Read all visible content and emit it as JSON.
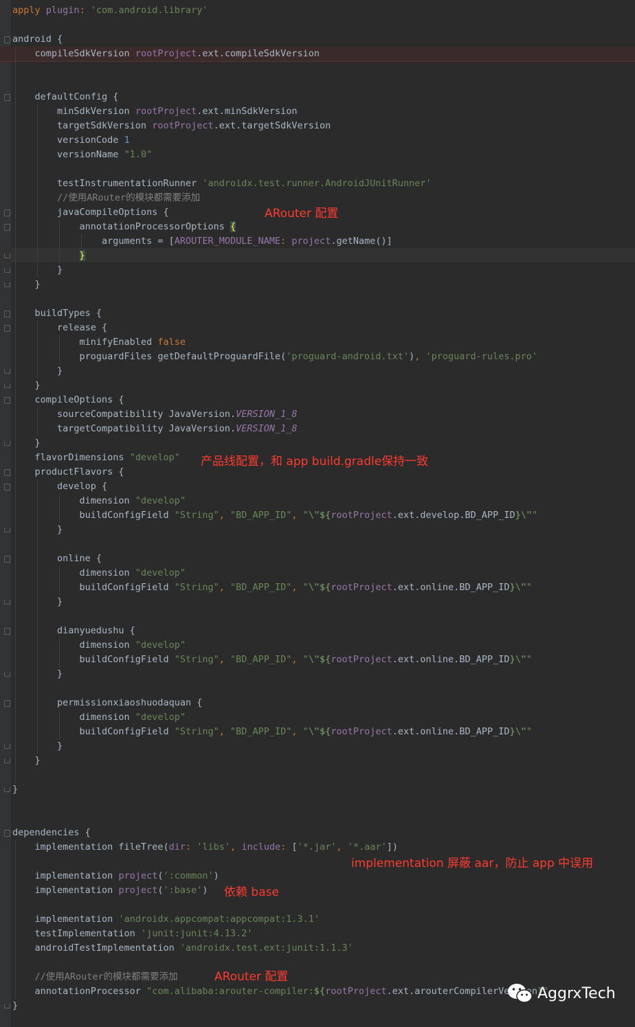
{
  "code": [
    "apply plugin: 'com.android.library'",
    "",
    "android {",
    "    compileSdkVersion rootProject.ext.compileSdkVersion",
    "",
    "",
    "    defaultConfig {",
    "        minSdkVersion rootProject.ext.minSdkVersion",
    "        targetSdkVersion rootProject.ext.targetSdkVersion",
    "        versionCode 1",
    "        versionName \"1.0\"",
    "",
    "        testInstrumentationRunner 'androidx.test.runner.AndroidJUnitRunner'",
    "        //使用ARouter的模块都需要添加",
    "        javaCompileOptions {",
    "            annotationProcessorOptions {",
    "                arguments = [AROUTER_MODULE_NAME: project.getName()]",
    "            }",
    "        }",
    "    }",
    "",
    "    buildTypes {",
    "        release {",
    "            minifyEnabled false",
    "            proguardFiles getDefaultProguardFile('proguard-android.txt'), 'proguard-rules.pro'",
    "        }",
    "    }",
    "    compileOptions {",
    "        sourceCompatibility JavaVersion.VERSION_1_8",
    "        targetCompatibility JavaVersion.VERSION_1_8",
    "    }",
    "    flavorDimensions \"develop\"",
    "    productFlavors {",
    "        develop {",
    "            dimension \"develop\"",
    "            buildConfigField \"String\", \"BD_APP_ID\", \"\\\"${rootProject.ext.develop.BD_APP_ID}\\\"\"",
    "        }",
    "",
    "        online {",
    "            dimension \"develop\"",
    "            buildConfigField \"String\", \"BD_APP_ID\", \"\\\"${rootProject.ext.online.BD_APP_ID}\\\"\"",
    "        }",
    "",
    "        dianyuedushu {",
    "            dimension \"develop\"",
    "            buildConfigField \"String\", \"BD_APP_ID\", \"\\\"${rootProject.ext.online.BD_APP_ID}\\\"\"",
    "        }",
    "",
    "        permissionxiaoshuodaquan {",
    "            dimension \"develop\"",
    "            buildConfigField \"String\", \"BD_APP_ID\", \"\\\"${rootProject.ext.online.BD_APP_ID}\\\"\"",
    "        }",
    "    }",
    "",
    "}",
    "",
    "",
    "dependencies {",
    "    implementation fileTree(dir: 'libs', include: ['*.jar', '*.aar'])",
    "",
    "    implementation project(':common')",
    "    implementation project(':base')",
    "",
    "    implementation 'androidx.appcompat:appcompat:1.3.1'",
    "    testImplementation 'junit:junit:4.13.2'",
    "    androidTestImplementation 'androidx.test.ext:junit:1.1.3'",
    "",
    "    //使用ARouter的模块都需要添加",
    "    annotationProcessor \"com.alibaba:arouter-compiler:${rootProject.ext.arouterCompilerVersion}\"",
    "}"
  ],
  "annotations": {
    "arouter_config_1": "ARouter 配置",
    "product_line": "产品线配置，和 app build.gradle保持一致",
    "implementation_note": "implementation  屏蔽 aar，防止 app 中误用",
    "depends_base": "依赖 base",
    "arouter_config_2": "ARouter 配置"
  },
  "watermark": {
    "icon": "wechat-icon",
    "text": "AggrxTech"
  },
  "colors": {
    "background": "#2b2b2b",
    "keyword": "#cc7832",
    "string": "#6a8759",
    "property": "#9876aa",
    "number": "#6897bb",
    "comment": "#808080",
    "annotation": "#ff3b30"
  }
}
